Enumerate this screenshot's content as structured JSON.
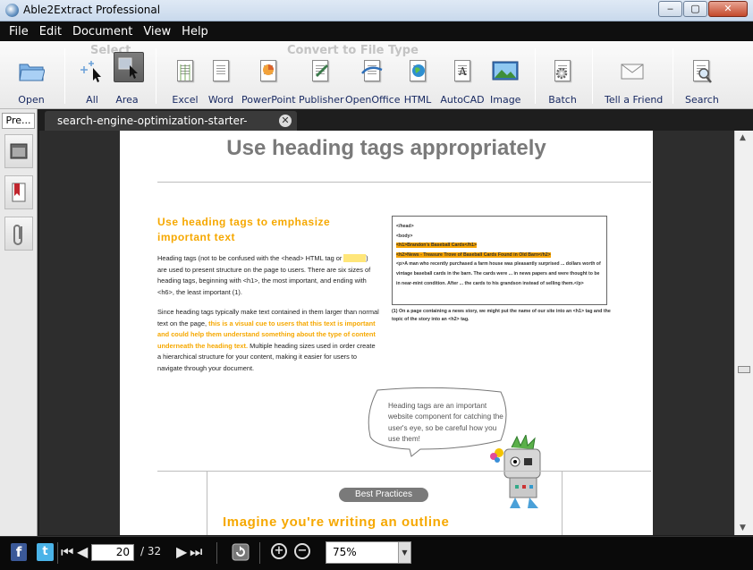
{
  "window": {
    "title": "Able2Extract Professional",
    "min": "‒",
    "max": "▢",
    "close": "✕"
  },
  "menu": [
    "File",
    "Edit",
    "Document",
    "View",
    "Help"
  ],
  "toolbar": {
    "select_group": "Select",
    "convert_group": "Convert to File Type",
    "open": "Open",
    "all": "All",
    "area": "Area",
    "excel": "Excel",
    "word": "Word",
    "powerpoint": "PowerPoint",
    "publisher": "Publisher",
    "openoffice": "OpenOffice",
    "html": "HTML",
    "autocad": "AutoCAD",
    "image": "Image",
    "batch": "Batch",
    "tell_friend": "Tell a Friend",
    "search": "Search"
  },
  "sidepanel": {
    "tab": "Pre..."
  },
  "document_tab": {
    "name": "search-engine-optimization-starter-guide.pdf",
    "close": "✕"
  },
  "page": {
    "title": "Use heading tags appropriately",
    "section_heading": "Use heading tags to emphasize important text",
    "p1_a": "Heading tags (not to be confused with the <head> HTML tag or ",
    "p1_b": ") are used to present structure on the page to users. There are six sizes of heading tags, beginning with <h1>, the most important, and ending with <h6>, the least important (1).",
    "p2_a": "Since heading tags typically make text contained in them larger than normal text on the page, ",
    "p2_hl": "this is a visual cue to users that this text is important and could help them understand something about the type of content underneath the heading text.",
    "p2_b": " Multiple heading sizes used in order create a hierarchical structure for your content, making it easier for users to navigate through your document.",
    "code_lines": [
      "</head>",
      "<body>"
    ],
    "code_h1": "<h1>Brandon's Baseball Cards</h1>",
    "code_h2": "<h2>News - Treasure Trove of Baseball Cards Found in Old Barn</h2>",
    "code_p": "<p>A man who recently purchased a farm house was pleasantly surprised ... dollars worth of vintage baseball cards in the barn. The cards were ... in news papers and were thought to be in near-mint condition. After ... the cards to his grandson instead of selling them.</p>",
    "caption": "(1) On a page containing a news story, we might put the name of our site into an <h1> tag and the topic of the story into an <h2> tag.",
    "bubble": "Heading tags are an important website component for catching the user's eye, so be careful how you use them!",
    "best_practices": "Best Practices",
    "outline_heading": "Imagine you're writing an outline"
  },
  "statusbar": {
    "facebook": "f",
    "twitter": "t",
    "current_page": "20",
    "total_pages": "/ 32",
    "zoom": "75%"
  }
}
